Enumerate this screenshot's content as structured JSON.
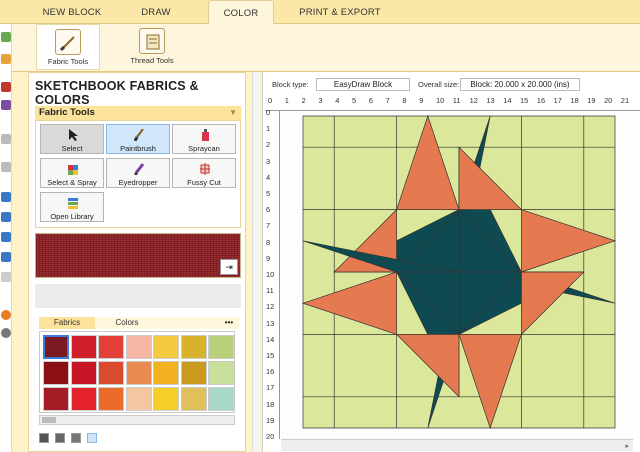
{
  "tabs": [
    {
      "label": "NEW BLOCK"
    },
    {
      "label": "DRAW"
    },
    {
      "label": "COLOR"
    },
    {
      "label": "PRINT & EXPORT"
    }
  ],
  "ribbon": {
    "fabric_tools": "Fabric Tools",
    "thread_tools": "Thread Tools"
  },
  "panel": {
    "title": "SKETCHBOOK FABRICS & COLORS",
    "fabric_tools_header": "Fabric Tools"
  },
  "tools": [
    {
      "label": "Select",
      "icon": "cursor-icon"
    },
    {
      "label": "Paintbrush",
      "icon": "paintbrush-icon"
    },
    {
      "label": "Spraycan",
      "icon": "spraycan-icon"
    },
    {
      "label": "Select & Spray",
      "icon": "select-spray-icon"
    },
    {
      "label": "Eyedropper",
      "icon": "eyedropper-icon"
    },
    {
      "label": "Fussy Cut",
      "icon": "fussy-cut-icon"
    },
    {
      "label": "Open Library",
      "icon": "open-library-icon"
    }
  ],
  "library": {
    "tab_fabrics": "Fabrics",
    "tab_colors": "Colors",
    "more": "•••"
  },
  "swatches": [
    "#7b1a22",
    "#d11f2b",
    "#e3403a",
    "#f7b6a4",
    "#f5c93f",
    "#d9b22c",
    "#b8d07a",
    "#8b1016",
    "#c81626",
    "#d94a30",
    "#e88a52",
    "#f2b11e",
    "#c99a1e",
    "#c8e09a",
    "#a51d24",
    "#e4232c",
    "#ec6a2a",
    "#f5c7a0",
    "#f4cf2a",
    "#e0c05a",
    "#a8d8c8"
  ],
  "colors": {
    "accent": "#fbe39a",
    "green_fabric": "#dbe79a",
    "orange_fabric": "#e5794f",
    "teal_fabric": "#0e4a52"
  },
  "block": {
    "type_label": "Block type:",
    "type_value": "EasyDraw Block",
    "size_label": "Overall size:",
    "size_value": "Block: 20.000 x 20.000 (ins)"
  },
  "ruler": {
    "top": [
      "0",
      "1",
      "2",
      "3",
      "4",
      "5",
      "6",
      "7",
      "8",
      "9",
      "10",
      "11",
      "12",
      "13",
      "14",
      "15",
      "16",
      "17",
      "18",
      "19",
      "20",
      "21"
    ],
    "left": [
      "0",
      "1",
      "2",
      "3",
      "4",
      "5",
      "6",
      "7",
      "8",
      "9",
      "10",
      "11",
      "12",
      "13",
      "14",
      "15",
      "16",
      "17",
      "18",
      "19",
      "20"
    ]
  }
}
